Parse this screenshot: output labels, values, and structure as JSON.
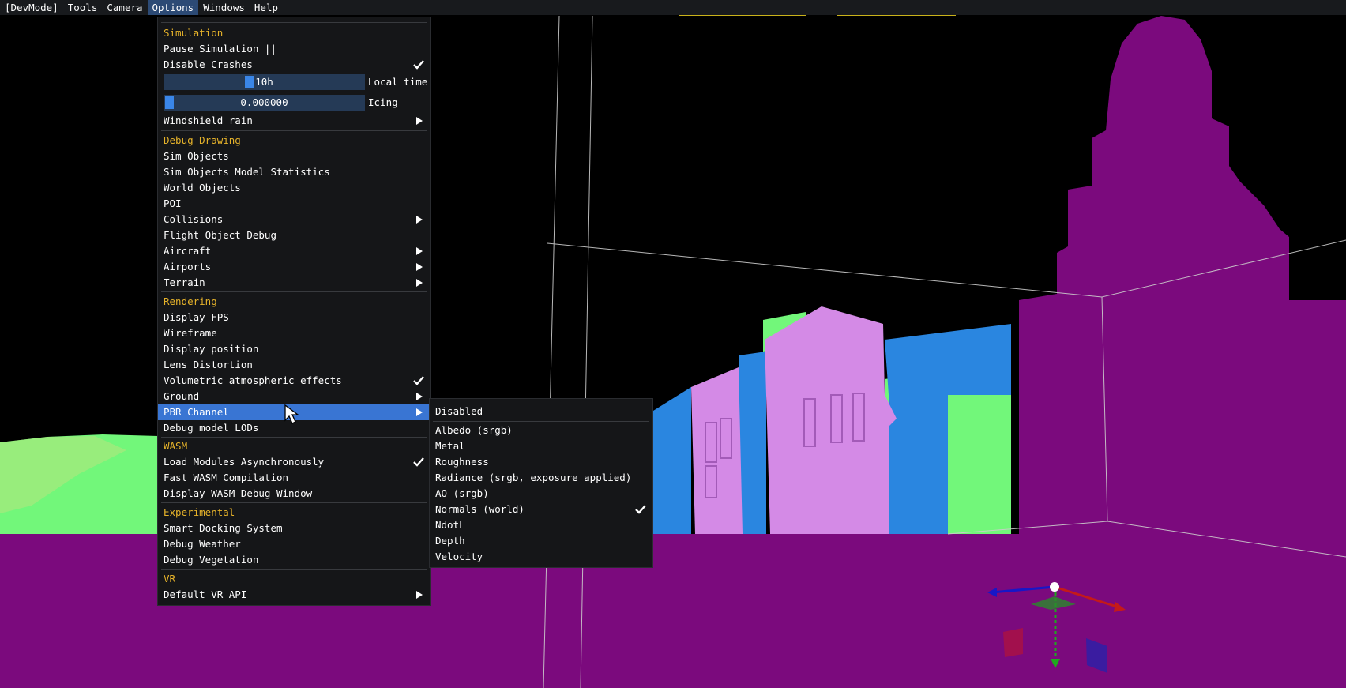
{
  "menubar": {
    "items": [
      "[DevMode]",
      "Tools",
      "Camera",
      "Options",
      "Windows",
      "Help"
    ],
    "active": "Options"
  },
  "options_menu": {
    "simulation": {
      "header": "Simulation",
      "pause": "Pause Simulation ||",
      "disable_crashes": "Disable Crashes",
      "local_time_value": "10h",
      "local_time_label": "Local time",
      "local_time_fraction": 0.42,
      "icing_value": "0.000000",
      "icing_label": "Icing",
      "icing_fraction": 0.0,
      "windshield_rain": "Windshield rain"
    },
    "debug_drawing": {
      "header": "Debug Drawing",
      "sim_objects": "Sim Objects",
      "sim_objects_stats": "Sim Objects Model Statistics",
      "world_objects": "World Objects",
      "poi": "POI",
      "collisions": "Collisions",
      "flight_object_debug": "Flight Object Debug",
      "aircraft": "Aircraft",
      "airports": "Airports",
      "terrain": "Terrain"
    },
    "rendering": {
      "header": "Rendering",
      "display_fps": "Display FPS",
      "wireframe": "Wireframe",
      "display_position": "Display position",
      "lens_distortion": "Lens Distortion",
      "volumetric": "Volumetric atmospheric effects",
      "ground": "Ground",
      "pbr_channel": "PBR Channel",
      "debug_model_lods": "Debug model LODs"
    },
    "wasm": {
      "header": "WASM",
      "load_async": "Load Modules Asynchronously",
      "fast_compile": "Fast WASM Compilation",
      "debug_window": "Display WASM Debug Window"
    },
    "experimental": {
      "header": "Experimental",
      "smart_docking": "Smart Docking System",
      "debug_weather": "Debug Weather",
      "debug_vegetation": "Debug Vegetation"
    },
    "vr": {
      "header": "VR",
      "default_api": "Default VR API"
    }
  },
  "pbr_menu": {
    "disabled": "Disabled",
    "albedo": "Albedo (srgb)",
    "metal": "Metal",
    "roughness": "Roughness",
    "radiance": "Radiance (srgb, exposure applied)",
    "ao": "AO (srgb)",
    "normals": "Normals (world)",
    "ndotl": "NdotL",
    "depth": "Depth",
    "velocity": "Velocity",
    "selected": "Normals (world)"
  },
  "colors": {
    "header_yellow": "#e5b22a",
    "highlight_blue": "#3975d3",
    "ground_magenta": "#7b0a7d",
    "building_pink": "#d48ae6",
    "building_blue": "#2a86e0",
    "grass_green": "#72f77a"
  }
}
